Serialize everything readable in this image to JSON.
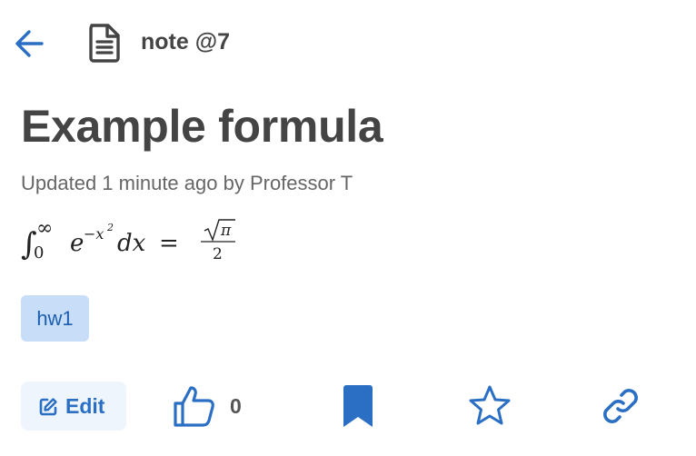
{
  "header": {
    "note_label": "note @7",
    "icons": {
      "back": "arrow-left-icon",
      "note": "document-icon"
    }
  },
  "post": {
    "title": "Example formula",
    "meta": "Updated 1 minute ago by Professor T",
    "formula": {
      "integral_lower": "0",
      "integral_upper": "∞",
      "base": "e",
      "exponent": "−x",
      "exponent_power": "2",
      "differential": "dx",
      "equals": "=",
      "numerator": "π",
      "denominator": "2"
    },
    "tags": [
      "hw1"
    ]
  },
  "actions": {
    "edit_label": "Edit",
    "like_count": "0",
    "icons": {
      "edit": "edit-icon",
      "like": "thumbs-up-icon",
      "bookmark": "bookmark-icon",
      "star": "star-icon",
      "link": "link-icon"
    }
  },
  "colors": {
    "accent": "#2a6fc4",
    "tag_bg": "#c8def8",
    "tag_text": "#1c5fb0",
    "edit_bg": "#eef5fd",
    "text": "#444444"
  }
}
